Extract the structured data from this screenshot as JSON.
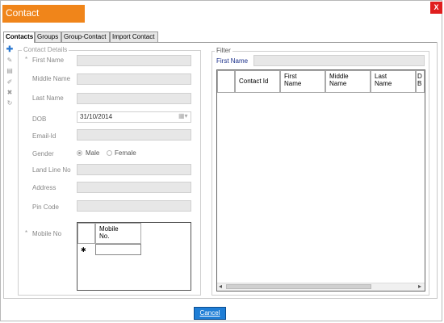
{
  "window": {
    "title": "Contact",
    "close_label": "X"
  },
  "tabs": [
    "Contacts",
    "Groups",
    "Group-Contact",
    "Import Contact"
  ],
  "toolbar": {
    "icons": [
      "add-icon",
      "edit-icon",
      "save-icon",
      "pencil-icon",
      "delete-icon",
      "refresh-icon"
    ]
  },
  "contact_details": {
    "legend": "Contact Details",
    "required_mark": "*",
    "first_name_label": "First Name",
    "middle_name_label": "Middle Name",
    "last_name_label": "Last Name",
    "dob_label": "DOB",
    "dob_value": "31/10/2014",
    "email_label": "Email-Id",
    "gender_label": "Gender",
    "gender_options": [
      "Male",
      "Female"
    ],
    "gender_selected": "Male",
    "landline_label": "Land Line No",
    "address_label": "Address",
    "pincode_label": "Pin Code",
    "mobile_label": "Mobile No",
    "mobile_grid": {
      "header_line1": "Mobile",
      "header_line2": "No.",
      "new_row_mark": "✱"
    }
  },
  "filter": {
    "legend": "Filter",
    "first_name_label": "First Name",
    "grid_columns": [
      {
        "l1": "Contact Id",
        "l2": ""
      },
      {
        "l1": "First",
        "l2": "Name"
      },
      {
        "l1": "Middle",
        "l2": "Name"
      },
      {
        "l1": "Last",
        "l2": "Name"
      },
      {
        "l1": "D",
        "l2": "B"
      }
    ],
    "scroll_left": "◂",
    "scroll_right": "▸"
  },
  "footer": {
    "cancel_label": "Cancel"
  },
  "colors": {
    "title_bg": "#f0851a",
    "close_bg": "#e01f1f",
    "cancel_bg": "#1f7ed6",
    "filter_label": "#1a2f8a"
  }
}
